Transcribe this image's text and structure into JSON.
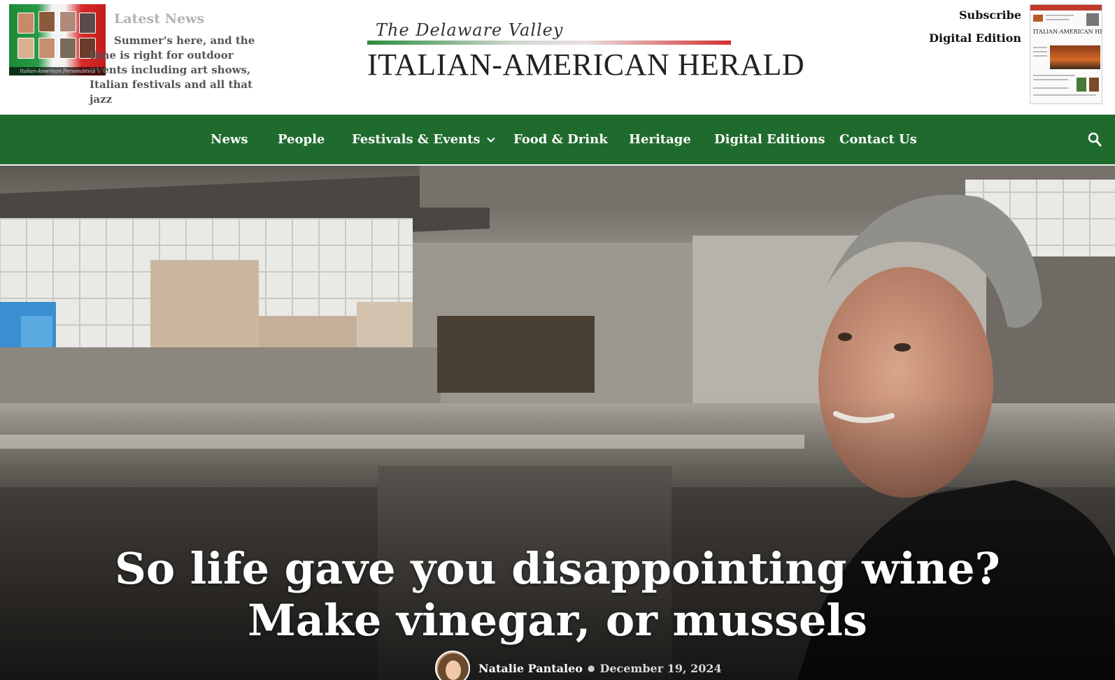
{
  "header": {
    "latest_news_label": "Latest News",
    "latest_news_text": "Summer's here, and the time is right for outdoor events including art shows, Italian festivals and all that jazz",
    "latest_thumb_caption": "Italian-American Personalities",
    "logo_script": "The Delaware Valley",
    "logo_main": "ITALIAN-AMERICAN HERALD",
    "subscribe_label": "Subscribe",
    "digital_edition_label": "Digital Edition",
    "paper_thumb_name": "ITALIAN-AMERICAN HERALD"
  },
  "nav": {
    "items": [
      {
        "label": "News"
      },
      {
        "label": "People"
      },
      {
        "label": "Festivals & Events"
      },
      {
        "label": "Food & Drink"
      },
      {
        "label": "Heritage"
      },
      {
        "label": "Digital Editions"
      },
      {
        "label": "Contact Us"
      }
    ],
    "search_icon": "search-icon",
    "dropdown_icon": "chevron-down-icon"
  },
  "hero": {
    "title_line1": "So life gave you disappointing wine?",
    "title_line2": "Make vinegar, or mussels",
    "author": "Natalie Pantaleo",
    "date": "December 19, 2024"
  },
  "colors": {
    "nav_background": "#1f6b2e",
    "latest_news_label": "#b3b3b3"
  }
}
